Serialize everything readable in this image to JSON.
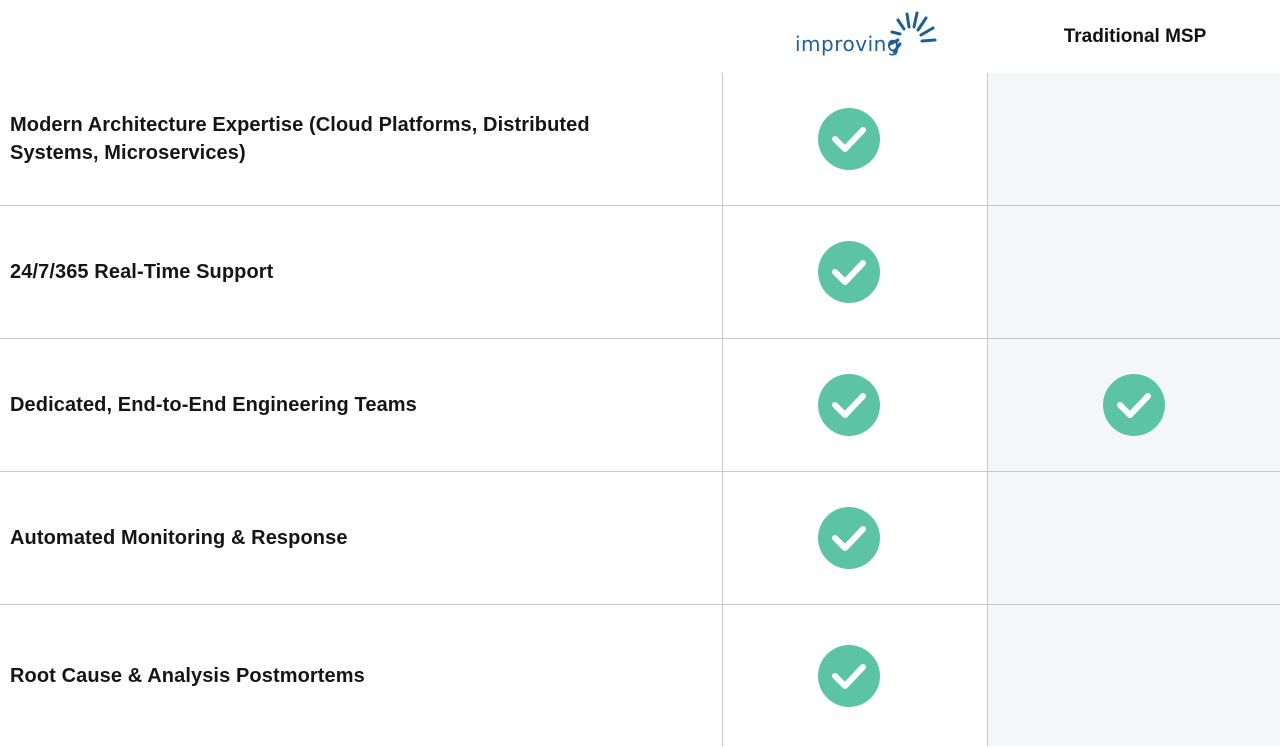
{
  "header": {
    "logo_text": "improving",
    "column_competitor": "Traditional MSP"
  },
  "colors": {
    "check_green": "#5cc4a2",
    "brand_blue": "#1d5f96",
    "msp_column_bg": "#f5f6f8",
    "divider": "#c8c8c8"
  },
  "rows": [
    {
      "label": "Modern Architecture Expertise (Cloud Platforms, Distributed Systems, Microservices)",
      "improving": true,
      "msp": false
    },
    {
      "label": "24/7/365 Real-Time Support",
      "improving": true,
      "msp": false
    },
    {
      "label": "Dedicated, End-to-End Engineering Teams",
      "improving": true,
      "msp": true
    },
    {
      "label": "Automated Monitoring & Response",
      "improving": true,
      "msp": false
    },
    {
      "label": "Root Cause & Analysis Postmortems",
      "improving": true,
      "msp": false
    }
  ],
  "icons": {
    "check": "check-icon"
  }
}
